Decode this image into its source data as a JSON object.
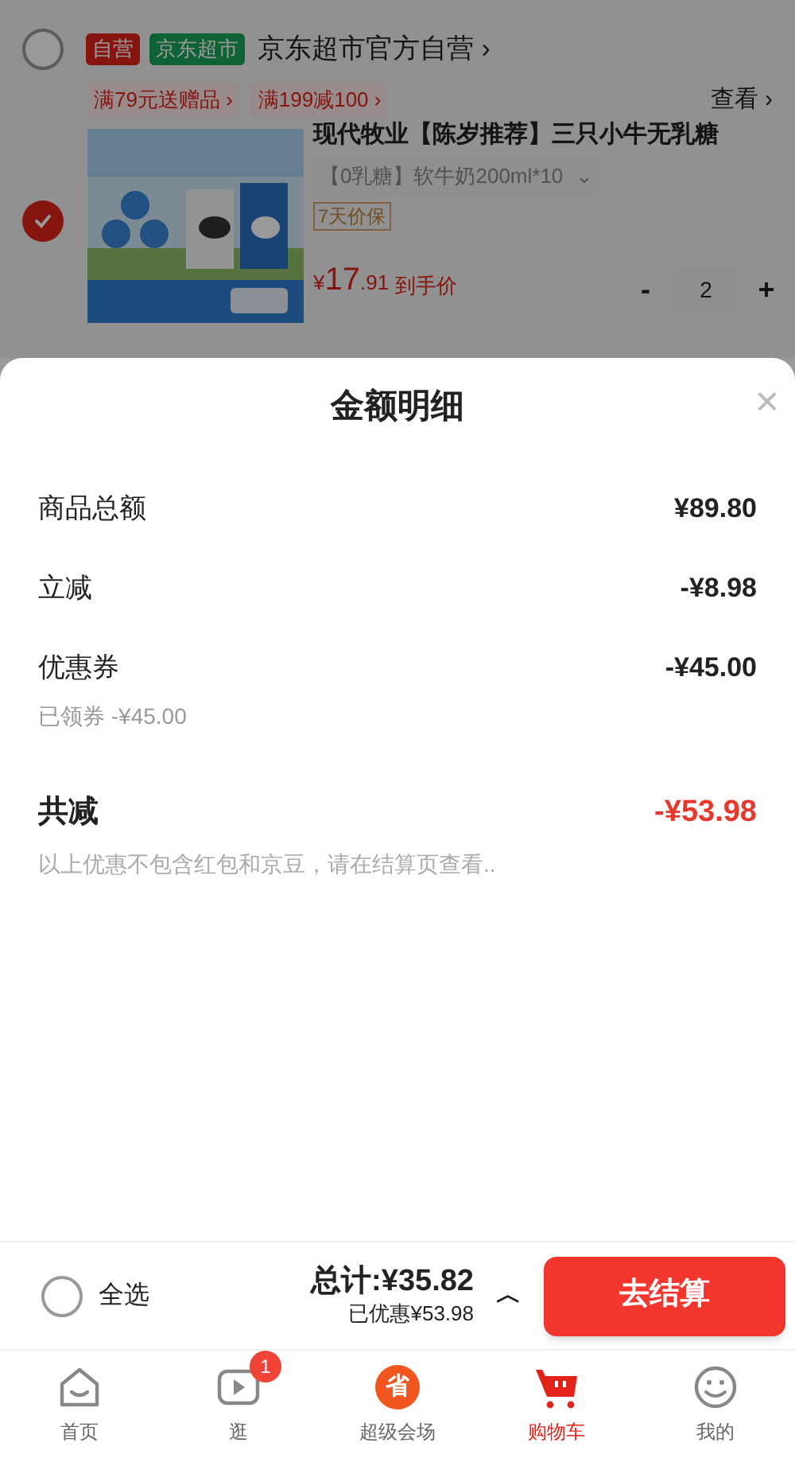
{
  "cart": {
    "store": {
      "checked": false,
      "badges": [
        {
          "text": "自营",
          "kind": "self"
        },
        {
          "text": "京东超市",
          "kind": "market"
        }
      ],
      "name": "京东超市官方自营 ›"
    },
    "promos": [
      "满79元送赠品 ›",
      "满199减100 ›"
    ],
    "view_link": "查看 ›",
    "item": {
      "checked": true,
      "title": "现代牧业【陈岁推荐】三只小牛无乳糖",
      "variant": "【0乳糖】软牛奶200ml*10",
      "variant_caret": "⌄",
      "tag": "7天价保",
      "price_symbol": "¥",
      "price_int": "17",
      "price_dec": ".91",
      "price_note": "到手价",
      "minus": "-",
      "quantity": "2",
      "plus": "+"
    }
  },
  "sheet": {
    "title": "金额明细",
    "close": "×",
    "rows": [
      {
        "label": "商品总额",
        "value": "¥89.80"
      },
      {
        "label": "立减",
        "value": "-¥8.98"
      },
      {
        "label": "优惠券",
        "value": "-¥45.00",
        "note": "已领券 -¥45.00"
      }
    ],
    "total": {
      "label": "共减",
      "value": "-¥53.98"
    },
    "footnote": "以上优惠不包含红包和京豆，请在结算页查看.."
  },
  "bottom_bar": {
    "select_all": {
      "label": "全选",
      "checked": false
    },
    "total": "总计:¥35.82",
    "saved": "已优惠¥53.98",
    "caret": "︿",
    "checkout": "去结算"
  },
  "tabs": [
    {
      "kind": "home",
      "label": "首页",
      "selected": false
    },
    {
      "kind": "video",
      "label": "逛",
      "selected": false,
      "badge": "1"
    },
    {
      "kind": "promo",
      "label": "超级会场",
      "selected": false,
      "icon_text": "省"
    },
    {
      "kind": "cart",
      "label": "购物车",
      "selected": true
    },
    {
      "kind": "me",
      "label": "我的",
      "selected": false
    }
  ]
}
